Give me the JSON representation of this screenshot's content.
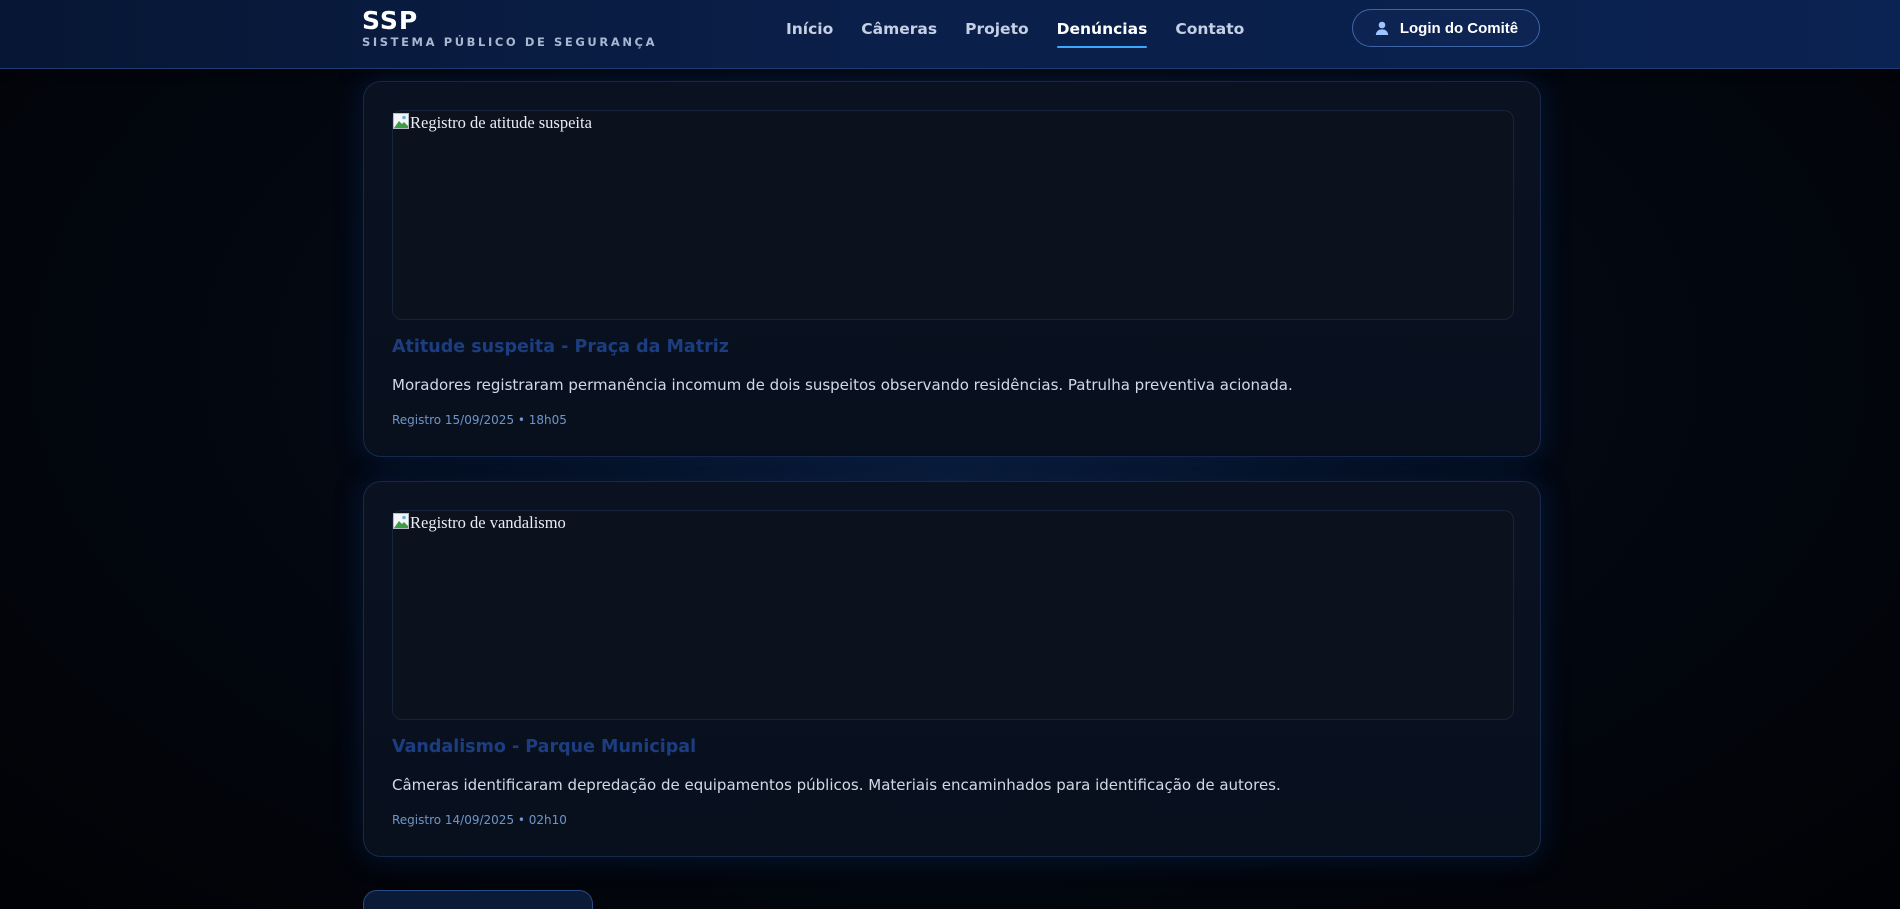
{
  "header": {
    "brand_name": "SSP",
    "brand_subtitle": "SISTEMA PÚBLICO DE SEGURANÇA",
    "nav": [
      {
        "label": "Início",
        "active": false
      },
      {
        "label": "Câmeras",
        "active": false
      },
      {
        "label": "Projeto",
        "active": false
      },
      {
        "label": "Denúncias",
        "active": true
      },
      {
        "label": "Contato",
        "active": false
      }
    ],
    "login_label": "Login do Comitê",
    "login_icon": "user-icon"
  },
  "reports": [
    {
      "image_alt": "Registro de atitude suspeita",
      "title": "Atitude suspeita - Praça da Matriz",
      "description": "Moradores registraram permanência incomum de dois suspeitos observando residências. Patrulha preventiva acionada.",
      "meta": "Registro 15/09/2025 • 18h05"
    },
    {
      "image_alt": "Registro de vandalismo",
      "title": "Vandalismo - Parque Municipal",
      "description": "Câmeras identificaram depredação de equipamentos públicos. Materiais encaminhados para identificação de autores.",
      "meta": "Registro 14/09/2025 • 02h10"
    }
  ],
  "colors": {
    "header_bg": "#0a1f49",
    "accent": "#3ba8ff",
    "title_blue": "#1c3d80",
    "meta_blue": "#6f95c9"
  }
}
